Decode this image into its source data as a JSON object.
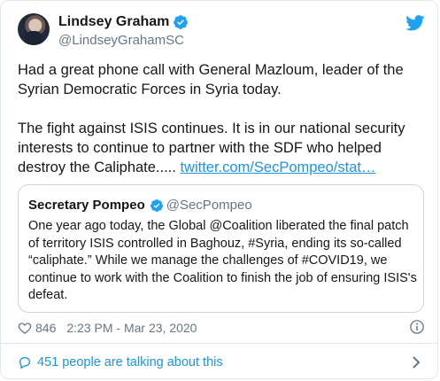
{
  "author": {
    "name": "Lindsey Graham",
    "handle": "@LindseyGrahamSC",
    "verified_icon": "verified-badge-icon",
    "avatar_icon": "avatar"
  },
  "brand": {
    "icon": "twitter-bird-icon",
    "color": "#1da1f2"
  },
  "tweet": {
    "para1": "Had a great phone call with General Mazloum, leader of the Syrian Democratic Forces in Syria today.",
    "para2_text": "The fight against ISIS continues.  It is in our national security interests to continue to partner with the SDF who helped destroy the Caliphate.....",
    "link": "twitter.com/SecPompeo/stat…"
  },
  "quote": {
    "name": "Secretary Pompeo",
    "handle": "@SecPompeo",
    "text": "One year ago today, the Global @Coalition liberated the final patch of territory ISIS controlled in Baghouz, #Syria, ending its so-called “caliphate.” While we manage the challenges of #COVID19, we continue to work with the Coalition to finish the job of ensuring ISIS's defeat."
  },
  "meta": {
    "likes": "846",
    "timestamp": "2:23 PM - Mar 23, 2020",
    "like_icon": "heart-icon",
    "info_icon": "info-icon"
  },
  "footer": {
    "label": "451 people are talking about this",
    "icon": "comment-icon",
    "chevron_icon": "chevron-right-icon"
  },
  "colors": {
    "link": "#1b95e0",
    "muted": "#657786",
    "border": "#e1e8ed"
  }
}
